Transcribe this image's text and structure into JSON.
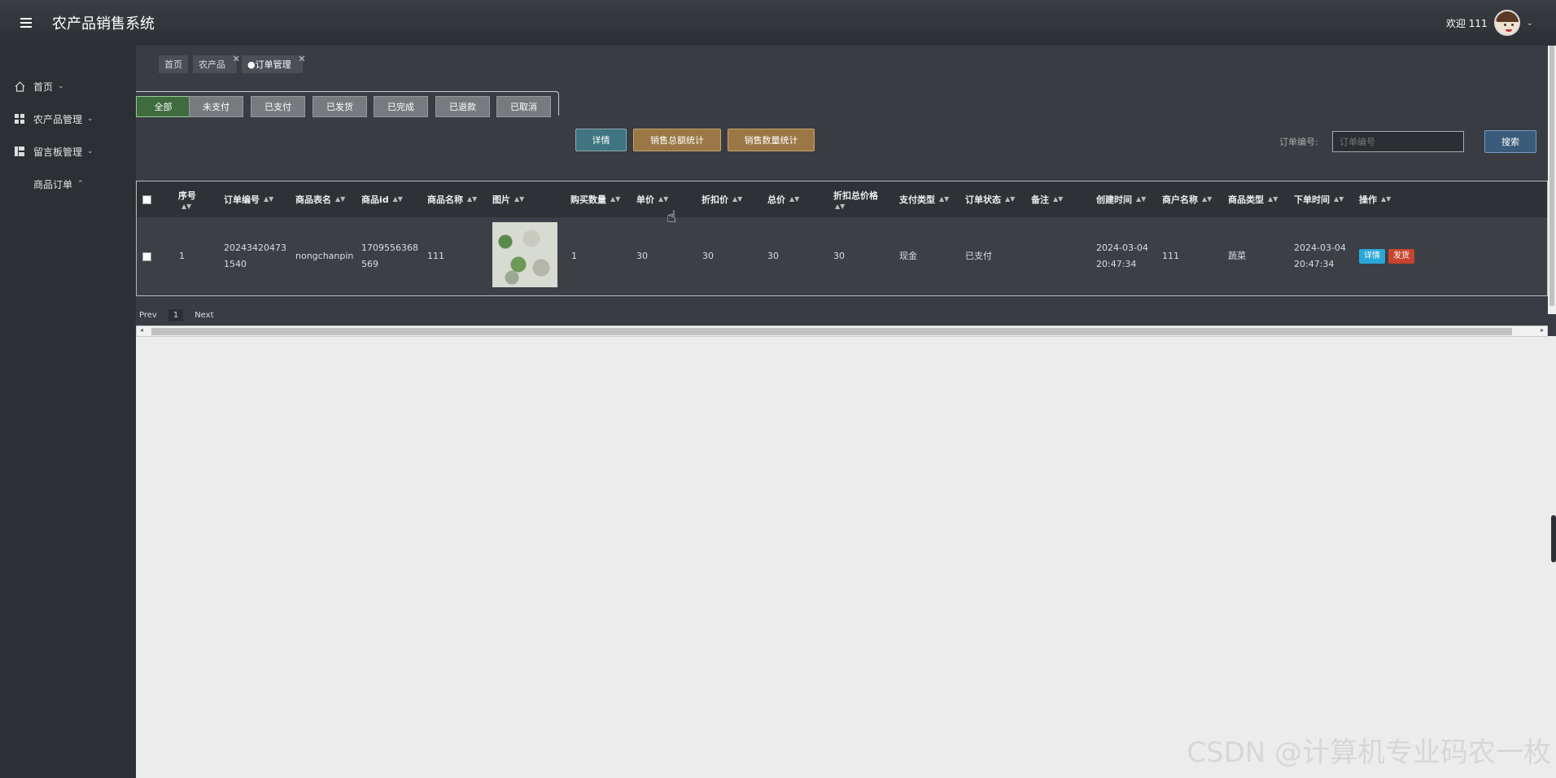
{
  "header": {
    "title": "农产品销售系统",
    "welcome": "欢迎 111"
  },
  "sidebar": {
    "items": [
      {
        "label": "首页"
      },
      {
        "label": "农产品管理"
      },
      {
        "label": "留言板管理"
      },
      {
        "label": "商品订单"
      }
    ]
  },
  "tabs": [
    {
      "label": "首页"
    },
    {
      "label": "农产品"
    },
    {
      "label": "●订单管理"
    }
  ],
  "status_tabs": [
    "全部",
    "未支付",
    "已支付",
    "已发货",
    "已完成",
    "已退款",
    "已取消"
  ],
  "actions": {
    "detail": "详情",
    "sales_amount": "销售总额统计",
    "sales_count": "销售数量统计"
  },
  "search": {
    "label": "订单编号:",
    "placeholder": "订单编号",
    "button": "搜索"
  },
  "table": {
    "columns": [
      "序号",
      "订单编号",
      "商品表名",
      "商品id",
      "商品名称",
      "图片",
      "购买数量",
      "单价",
      "折扣价",
      "总价",
      "折扣总价格",
      "支付类型",
      "订单状态",
      "备注",
      "创建时间",
      "商户名称",
      "商品类型",
      "下单时间",
      "操作"
    ],
    "rows": [
      {
        "index": "1",
        "order_no_1": "20243420473",
        "order_no_2": "1540",
        "table_name": "nongchanpin",
        "goods_id_1": "1709556368",
        "goods_id_2": "569",
        "goods_name": "111",
        "quantity": "1",
        "price": "30",
        "discount_price": "30",
        "total": "30",
        "discount_total": "30",
        "pay_type": "现金",
        "status": "已支付",
        "remark": "",
        "created_1": "2024-03-04",
        "created_2": "20:47:34",
        "merchant": "111",
        "goods_type": "蔬菜",
        "order_time_1": "2024-03-04",
        "order_time_2": "20:47:34",
        "op_detail": "详情",
        "op_ship": "发货"
      }
    ]
  },
  "pager": {
    "prev": "Prev",
    "current": "1",
    "next": "Next"
  },
  "watermark": "CSDN @计算机专业码农一枚"
}
